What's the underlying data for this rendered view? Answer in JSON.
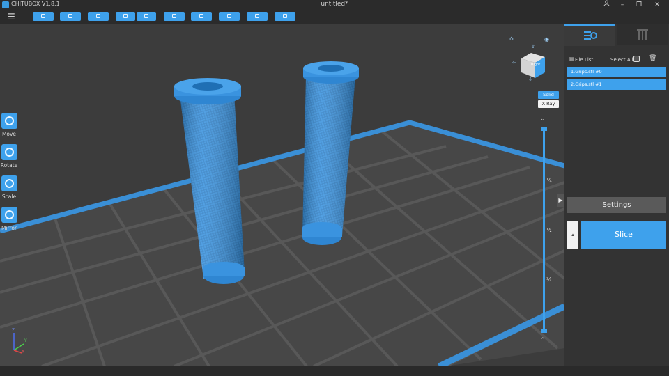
{
  "app": {
    "title": "CHITUBOX V1.8.1",
    "document_title": "untitled*",
    "window_controls": {
      "user_icon": "user-icon",
      "minimize": "–",
      "restore": "❐",
      "close": "✕"
    }
  },
  "toolbar": {
    "menu_icon": "☰",
    "buttons": [
      {
        "icon": "open-file-icon"
      },
      {
        "icon": "save-icon"
      },
      {
        "icon": "select-icon"
      },
      {
        "icon": "undo-icon"
      },
      {
        "icon": "redo-icon"
      },
      {
        "icon": "center-icon"
      },
      {
        "icon": "arrange-icon"
      },
      {
        "icon": "support-icon"
      },
      {
        "icon": "hollow-icon"
      },
      {
        "icon": "lock-icon"
      }
    ]
  },
  "tools": [
    {
      "label": "Move",
      "icon": "move-icon"
    },
    {
      "label": "Rotate",
      "icon": "rotate-icon"
    },
    {
      "label": "Scale",
      "icon": "scale-icon"
    },
    {
      "label": "Mirror",
      "icon": "mirror-icon"
    }
  ],
  "view": {
    "cube_face": "Right",
    "solid_label": "Solid",
    "xray_label": "X-Ray",
    "ticks": [
      "¼",
      "½",
      "¾"
    ],
    "axes": {
      "x": "X",
      "y": "Y",
      "z": "Z"
    }
  },
  "panel": {
    "tabs": [
      {
        "icon": "model-settings-icon"
      },
      {
        "icon": "support-tab-icon"
      }
    ],
    "file_list_label": "File List:",
    "select_all_label": "Select All",
    "files": [
      "1.Grips.stl #0",
      "2.Grips.stl #1"
    ],
    "settings_label": "Settings",
    "slice_label": "Slice",
    "expander": "▶"
  },
  "colors": {
    "accent": "#3ea1ec",
    "background": "#3c3c3c",
    "model": "#3a93df"
  }
}
